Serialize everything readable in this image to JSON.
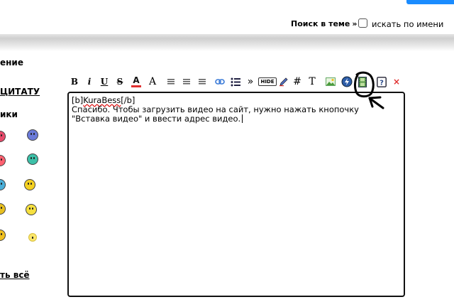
{
  "topbar": {
    "search_link": "Поиск в теме",
    "search_arrow": "»",
    "search_by_name_label": "искать по имени",
    "search_by_name_checked": false
  },
  "left_panel": {
    "heading_1": "ение",
    "quote_link": "ЦИТАТУ",
    "heading_smileys": "ики",
    "show_all_link": "ть всё"
  },
  "toolbar": {
    "bold": "B",
    "italic": "i",
    "underline": "U",
    "strike": "S",
    "font_color": "A",
    "font_size": "A",
    "quote_mark": "»",
    "hide": "HIDE",
    "hash": "#",
    "text": "T",
    "close": "×",
    "icons": [
      "bold-icon",
      "italic-icon",
      "underline-icon",
      "strikethrough-icon",
      "font-color-icon",
      "font-size-icon",
      "align-left-icon",
      "align-center-icon",
      "align-right-icon",
      "link-icon",
      "list-icon",
      "quote-icon",
      "hide-icon",
      "pencil-icon",
      "hash-icon",
      "text-icon",
      "image-icon",
      "flash-icon",
      "video-icon",
      "help-icon",
      "close-icon"
    ]
  },
  "editor": {
    "line1_open": "[b]",
    "line1_name": "KuraBess",
    "line1_close": "[/b]",
    "body": "Спасибо. Чтобы загрузить видео на сайт, нужно нажать кнопочку \"Вставка видео\" и ввести адрес видео."
  },
  "colors": {
    "accent_blue": "#1a8cff",
    "close_red": "#e03030",
    "border": "#111111"
  }
}
